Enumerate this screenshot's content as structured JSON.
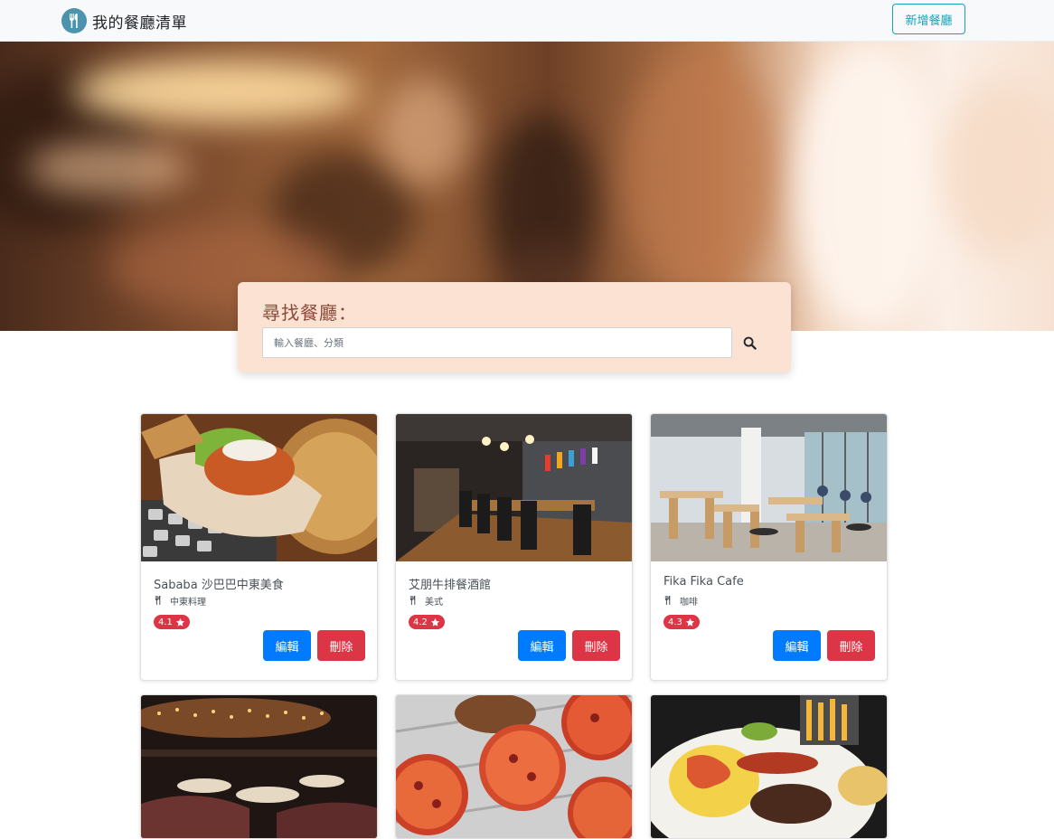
{
  "navbar": {
    "brand_title": "我的餐廳清單",
    "add_button_label": "新增餐廳",
    "brand_icon": "utensils-icon"
  },
  "search": {
    "title": "尋找餐廳：",
    "placeholder": "輸入餐廳、分類",
    "value": "",
    "button_icon": "search-icon"
  },
  "restaurants": [
    {
      "name": "Sababa 沙巴巴中東美食",
      "category": "中東料理",
      "rating": "4.1",
      "edit_label": "編輯",
      "delete_label": "刪除"
    },
    {
      "name": "艾朋牛排餐酒館",
      "category": "美式",
      "rating": "4.2",
      "edit_label": "編輯",
      "delete_label": "刪除"
    },
    {
      "name": "Fika Fika Cafe",
      "category": "咖啡",
      "rating": "4.3",
      "edit_label": "編輯",
      "delete_label": "刪除"
    },
    {
      "name": "",
      "category": "",
      "rating": "",
      "edit_label": "",
      "delete_label": ""
    },
    {
      "name": "",
      "category": "",
      "rating": "",
      "edit_label": "",
      "delete_label": ""
    },
    {
      "name": "",
      "category": "",
      "rating": "",
      "edit_label": "",
      "delete_label": ""
    }
  ],
  "colors": {
    "primary": "#007bff",
    "danger": "#dc3545",
    "info": "#17a2b8",
    "search_panel": "#fbe2d3",
    "search_title": "#8b4a37"
  }
}
